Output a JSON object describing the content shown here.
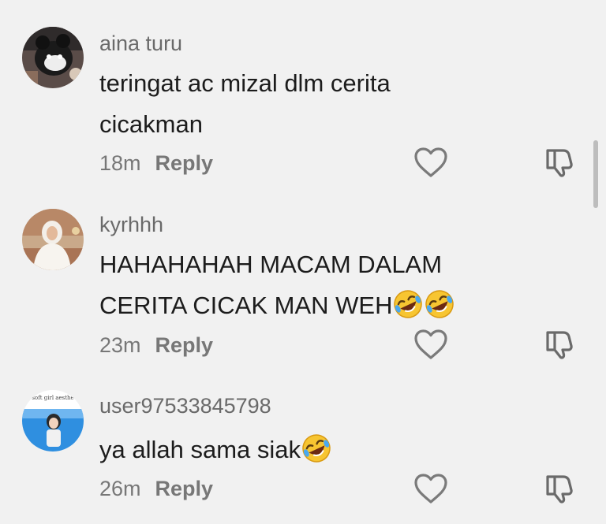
{
  "comments": [
    {
      "username": "aina turu",
      "text_line1": "teringat ac mizal dlm cerita",
      "text_line2": "cicakman",
      "time": "18m",
      "reply_label": "Reply",
      "avatar_icon": "avatar-plush-toy"
    },
    {
      "username": "kyrhhh",
      "text_line1": "HAHAHAHAH MACAM DALAM",
      "text_line2": "CERITA CICAK MAN WEH",
      "emojis": [
        "rolling-on-floor-laughing-emoji",
        "rolling-on-floor-laughing-emoji"
      ],
      "time": "23m",
      "reply_label": "Reply",
      "avatar_icon": "avatar-person-hijab"
    },
    {
      "username": "user97533845798",
      "text_line1": "ya allah sama siak",
      "emojis": [
        "rolling-on-floor-laughing-emoji"
      ],
      "time": "26m",
      "reply_label": "Reply",
      "avatar_icon": "avatar-soft-girl",
      "avatar_caption": "soft girl aesthe"
    }
  ],
  "icons": {
    "like": "heart-outline-icon",
    "dislike": "thumbs-down-outline-icon"
  },
  "colors": {
    "background": "#f1f1f1",
    "text": "#1c1c1c",
    "muted": "#777777"
  }
}
